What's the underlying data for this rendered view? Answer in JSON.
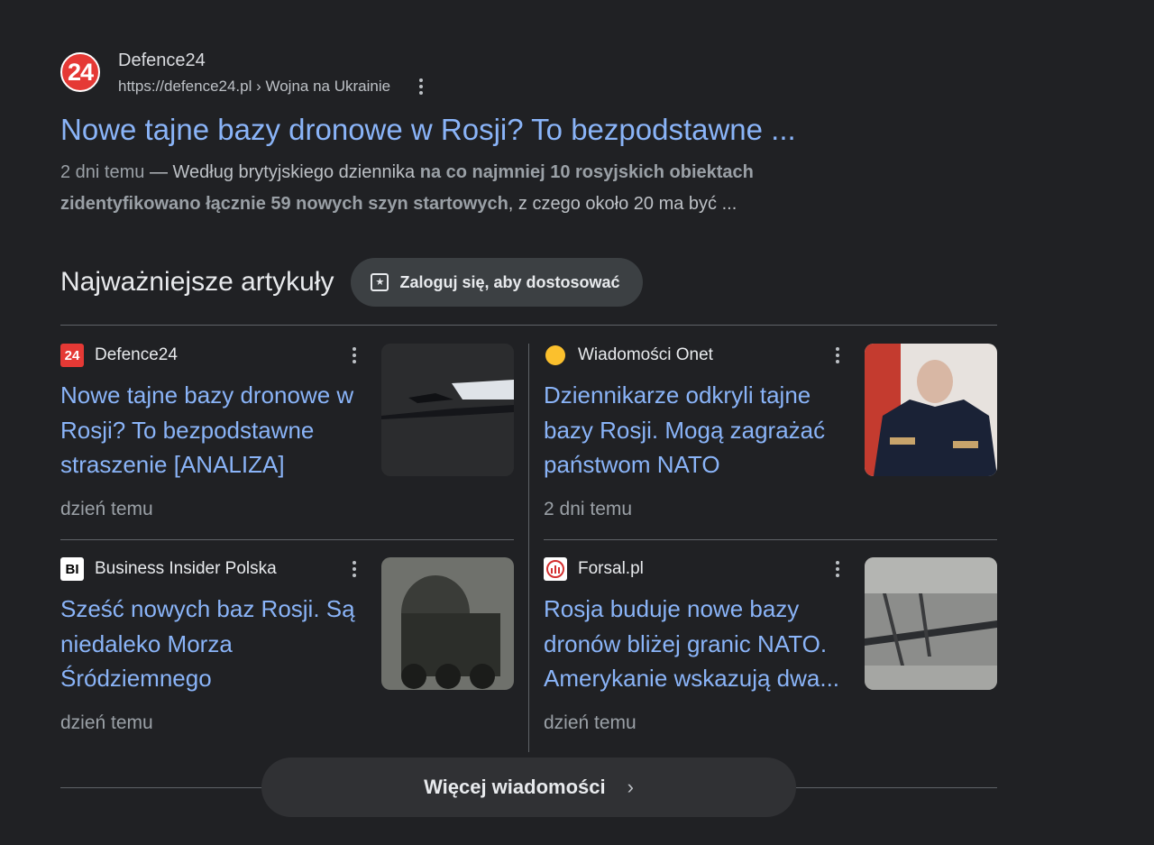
{
  "result": {
    "site_name": "Defence24",
    "logo_text": "24",
    "url": "https://defence24.pl › Wojna na Ukrainie",
    "title": "Nowe tajne bazy dronowe w Rosji? To bezpodstawne ...",
    "snippet_date": "2 dni temu",
    "snippet_dash": " — ",
    "snippet_lead": "Według brytyjskiego dziennika ",
    "snippet_bold": "na co najmniej 10 rosyjskich obiektach zidentyfikowano łącznie 59 nowych szyn startowych",
    "snippet_tail": ", z czego około 20 ma być ..."
  },
  "top_stories": {
    "title": "Najważniejsze artykuły",
    "login_label": "Zaloguj się, aby dostosować",
    "cards": [
      {
        "source": "Defence24",
        "favicon_text": "24",
        "favicon_color": "#e53935",
        "title": "Nowe tajne bazy dronowe w Rosji? To bezpodstawne straszenie [ANALIZA]",
        "time": "dzień temu"
      },
      {
        "source": "Wiadomości Onet",
        "favicon_text": "",
        "favicon_color": "#fbc02d",
        "title": "Dziennikarze odkryli tajne bazy Rosji. Mogą zagrażać państwom NATO",
        "time": "2 dni temu"
      },
      {
        "source": "Business Insider Polska",
        "favicon_text": "BI",
        "favicon_color": "#ffffff",
        "title": "Sześć nowych baz Rosji. Są niedaleko Morza Śródziemnego",
        "time": "dzień temu"
      },
      {
        "source": "Forsal.pl",
        "favicon_text": "",
        "favicon_color": "#ffffff",
        "title": "Rosja buduje nowe bazy dronów bliżej granic NATO. Amerykanie wskazują dwa...",
        "time": "dzień temu"
      }
    ]
  },
  "more_news_label": "Więcej wiadomości",
  "colors": {
    "background": "#202124",
    "link": "#8ab4f8",
    "text": "#bdc1c6"
  }
}
